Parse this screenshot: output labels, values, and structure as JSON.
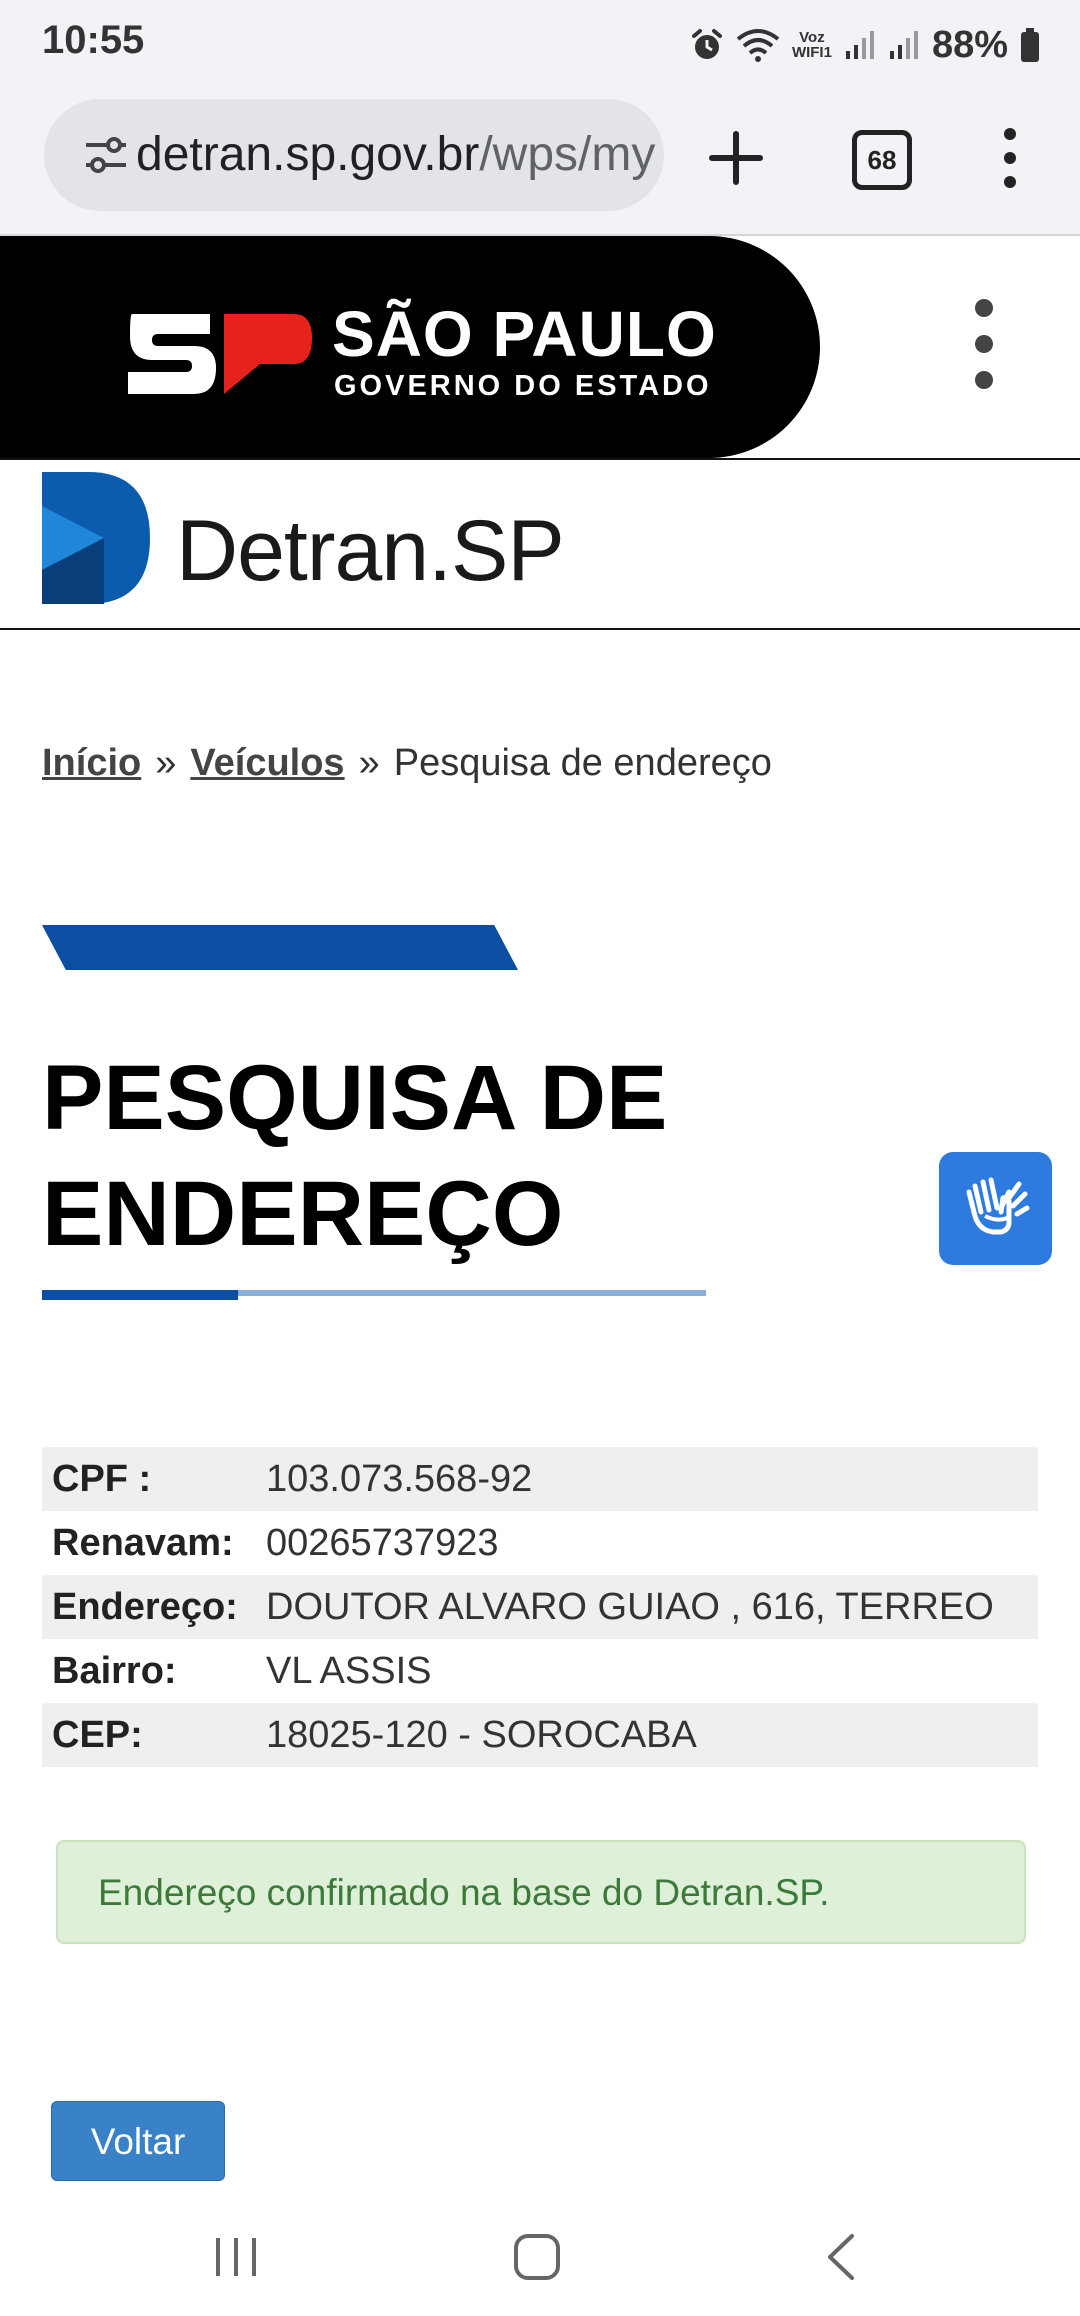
{
  "status_bar": {
    "time": "10:55",
    "voz_line1": "Voz",
    "voz_line2": "WIFI1",
    "battery": "88%",
    "icons": [
      "alarm-icon",
      "wifi-icon",
      "signal-icon",
      "signal-icon",
      "battery-icon"
    ]
  },
  "browser": {
    "url_host": "detran.sp.gov.br",
    "url_path": "/wps/my",
    "tab_count": "68",
    "icons": [
      "site-settings-icon",
      "new-tab-icon",
      "tabs-icon",
      "menu-icon"
    ]
  },
  "gov_header": {
    "logo_letters": "SP",
    "title": "SÃO PAULO",
    "subtitle": "GOVERNO DO ESTADO",
    "menu_icon": "kebab-menu-icon"
  },
  "detran": {
    "brand": "Detran",
    "brand_suffix": ".SP"
  },
  "breadcrumb": {
    "items": [
      "Início",
      "Veículos"
    ],
    "current": "Pesquisa de endereço",
    "separator": "»"
  },
  "page": {
    "title_line1": "PESQUISA DE",
    "title_line2": "ENDEREÇO",
    "accent_color": "#0b4ea2"
  },
  "accessibility_button": {
    "icon": "sign-language-hands-icon",
    "color": "#2e7be0"
  },
  "record": {
    "rows": [
      {
        "label": "CPF :",
        "value": "103.073.568-92"
      },
      {
        "label": "Renavam:",
        "value": "00265737923"
      },
      {
        "label": "Endereço:",
        "value": "DOUTOR ALVARO GUIAO , 616, TERREO"
      },
      {
        "label": "Bairro:",
        "value": "VL ASSIS"
      },
      {
        "label": "CEP:",
        "value": "18025-120 - SOROCABA"
      }
    ]
  },
  "alert": {
    "message": "Endereço confirmado na base do Detran.SP.",
    "color": "#3c7a3a"
  },
  "actions": {
    "back_label": "Voltar"
  },
  "nav_bar": {
    "icons": [
      "recent-apps-icon",
      "home-icon",
      "back-icon"
    ]
  }
}
